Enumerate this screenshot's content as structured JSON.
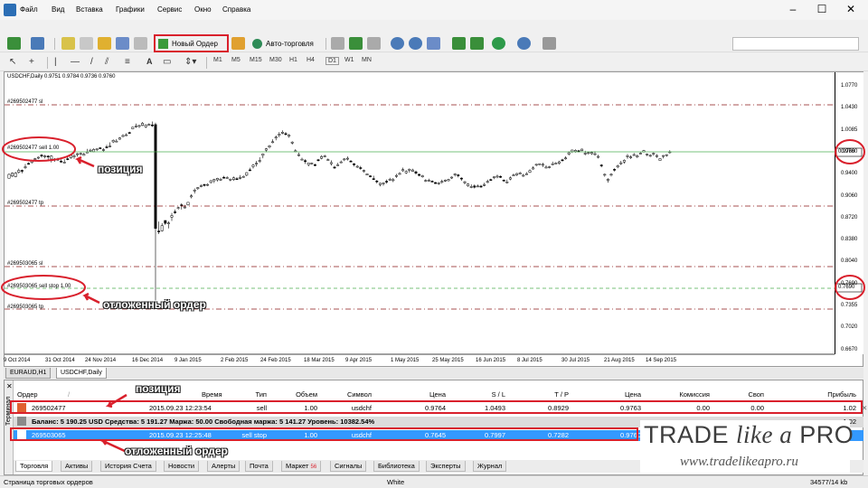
{
  "menu": [
    "Файл",
    "Вид",
    "Вставка",
    "Графики",
    "Сервис",
    "Окно",
    "Справка"
  ],
  "window_controls": {
    "minimize": "–",
    "maximize": "☐",
    "close": "✕"
  },
  "inner_controls": {
    "minimize": "_",
    "close": "✕"
  },
  "toolbar": {
    "new_order": "Новый Ордер",
    "auto_trading": "Авто-торговля"
  },
  "timeframes": [
    "M1",
    "M5",
    "M15",
    "M30",
    "H1",
    "H4",
    "D1",
    "W1",
    "MN"
  ],
  "chart": {
    "title": "USDCHF,Daily  0.9751 0.9784 0.9736 0.9760",
    "price_labels": [
      "1.0770",
      "1.0430",
      "1.0085",
      "0.9760",
      "0.9400",
      "0.9060",
      "0.8720",
      "0.8380",
      "0.8040",
      "0.7690",
      "0.7355",
      "0.7020",
      "0.6670"
    ],
    "date_labels": [
      "9 Oct 2014",
      "31 Oct 2014",
      "24 Nov 2014",
      "16 Dec 2014",
      "9 Jan 2015",
      "2 Feb 2015",
      "24 Feb 2015",
      "18 Mar 2015",
      "9 Apr 2015",
      "1 May 2015",
      "25 May 2015",
      "16 Jun 2015",
      "8 Jul 2015",
      "30 Jul 2015",
      "21 Aug 2015",
      "14 Sep 2015"
    ],
    "lines": {
      "l1": "#269502477 sl",
      "l2": "#269502477 sell 1.00",
      "l3": "#269502477 tp",
      "l4": "#269503065 sl",
      "l5": "#269503065 sell stop 1.00",
      "l6": "#269503065 tp"
    },
    "current_price": "0.9760",
    "pending_price": "0.7690"
  },
  "annotations": {
    "position": "позиция",
    "pending_order": "отложенный ордер"
  },
  "chart_tabs": [
    "EURAUD,H1",
    "USDCHF,Daily"
  ],
  "terminal": {
    "side_label": "Терминал",
    "headers": {
      "order": "Ордер",
      "time": "Время",
      "type": "Тип",
      "volume": "Объем",
      "symbol": "Символ",
      "price": "Цена",
      "sl": "S / L",
      "tp": "T / P",
      "price2": "Цена",
      "commission": "Комиссия",
      "swap": "Своп",
      "profit": "Прибыль"
    },
    "row1": {
      "order": "269502477",
      "time": "2015.09.23 12:23:54",
      "type": "sell",
      "volume": "1.00",
      "symbol": "usdchf",
      "price": "0.9764",
      "sl": "1.0493",
      "tp": "0.8929",
      "price2": "0.9763",
      "commission": "0.00",
      "swap": "0.00",
      "profit": "1.02"
    },
    "balance": "Баланс: 5 190.25 USD  Средства: 5 191.27  Маржа: 50.00  Свободная маржа: 5 141.27  Уровень: 10382.54%",
    "balance_profit": "1.02",
    "row2": {
      "order": "269503065",
      "time": "2015.09.23 12:25:48",
      "type": "sell stop",
      "volume": "1.00",
      "symbol": "usdchf",
      "price": "0.7645",
      "sl": "0.7997",
      "tp": "0.7282",
      "price2": "0.9760"
    },
    "tabs": [
      "Торговля",
      "Активы",
      "История Счета",
      "Новости",
      "Алерты",
      "Почта",
      "Маркет",
      "Сигналы",
      "Библиотека",
      "Эксперты",
      "Журнал"
    ],
    "market_badge": "56"
  },
  "status": {
    "left": "Страница торговых ордеров",
    "center": "White",
    "right": "34577/14 kb"
  },
  "logo": {
    "line1a": "TRADE",
    "line1b": "like a",
    "line1c": "PRO",
    "line2": "www.tradelikeapro.ru"
  },
  "colors": {
    "accent_red": "#d9202c",
    "selected_blue": "#3399ff",
    "sl_tp_line": "#8b1a1a",
    "entry_line": "#4caf50"
  },
  "candles": [
    [
      0.9351,
      0.9425,
      0.9357,
      0.9411
    ],
    [
      0.9384,
      0.9442,
      0.9371,
      0.9431
    ],
    [
      0.9375,
      0.9449,
      0.9366,
      0.9431
    ],
    [
      0.9442,
      0.9499,
      0.9422,
      0.9474
    ],
    [
      0.9473,
      0.9485,
      0.9427,
      0.9469
    ],
    [
      0.9525,
      0.9571,
      0.9492,
      0.9528
    ],
    [
      0.9581,
      0.9597,
      0.9562,
      0.9579
    ],
    [
      0.9595,
      0.9638,
      0.9578,
      0.9626
    ],
    [
      0.9643,
      0.9665,
      0.9627,
      0.9654
    ],
    [
      0.9675,
      0.9687,
      0.9647,
      0.9676
    ],
    [
      0.9709,
      0.9729,
      0.9669,
      0.9705
    ],
    [
      0.9694,
      0.9712,
      0.9658,
      0.9696
    ],
    [
      0.9694,
      0.9707,
      0.9638,
      0.9688
    ],
    [
      0.9648,
      0.9705,
      0.9595,
      0.9694
    ],
    [
      0.9648,
      0.9662,
      0.9606,
      0.9638
    ],
    [
      0.9639,
      0.9669,
      0.9618,
      0.9647
    ],
    [
      0.9616,
      0.9646,
      0.9589,
      0.9609
    ],
    [
      0.9599,
      0.9645,
      0.9583,
      0.9601
    ],
    [
      0.9653,
      0.9681,
      0.9631,
      0.9641
    ],
    [
      0.9667,
      0.9711,
      0.9652,
      0.9705
    ],
    [
      0.9682,
      0.9725,
      0.9651,
      0.9698
    ],
    [
      0.9718,
      0.9742,
      0.9685,
      0.9731
    ],
    [
      0.9721,
      0.9747,
      0.9706,
      0.9735
    ],
    [
      0.9705,
      0.9745,
      0.9702,
      0.9722
    ],
    [
      0.9752,
      0.9805,
      0.9746,
      0.9757
    ],
    [
      0.9785,
      0.9808,
      0.9783,
      0.9786
    ],
    [
      0.9761,
      0.9815,
      0.9753,
      0.9798
    ],
    [
      0.9795,
      0.981,
      0.9773,
      0.9805
    ],
    [
      0.9822,
      0.9834,
      0.9804,
      0.9812
    ],
    [
      0.9781,
      0.9817,
      0.9759,
      0.9795
    ],
    [
      0.9837,
      0.9869,
      0.9813,
      0.9829
    ],
    [
      0.9847,
      0.9907,
      0.9828,
      0.9852
    ],
    [
      0.9914,
      0.9953,
      0.9896,
      0.9938
    ],
    [
      0.9922,
      0.9958,
      0.9917,
      0.9926
    ],
    [
      0.9955,
      0.9987,
      0.9946,
      0.9976
    ],
    [
      0.9997,
      1.0032,
      0.9988,
      1.0012
    ],
    [
      1.0022,
      1.0047,
      1.0007,
      1.0024
    ],
    [
      1.0059,
      1.0071,
      1.0045,
      1.0053
    ],
    [
      1.0116,
      1.0147,
      1.0109,
      1.0141
    ],
    [
      1.0149,
      1.0197,
      1.0133,
      1.016
    ],
    [
      1.0164,
      1.0178,
      1.0129,
      1.0167
    ],
    [
      1.0169,
      1.0222,
      1.0158,
      1.0203
    ],
    [
      1.0146,
      1.0187,
      1.0127,
      1.0174
    ],
    [
      1.0183,
      1.02,
      1.0164,
      1.0187
    ],
    [
      1.0177,
      1.0228,
      1.0145,
      1.0164
    ],
    [
      1.0182,
      1.0212,
      0.746,
      0.8573
    ],
    [
      0.8534,
      0.8681,
      0.8486,
      0.8533
    ],
    [
      0.8537,
      0.8656,
      0.8526,
      0.8618
    ],
    [
      0.8697,
      0.8697,
      0.8629,
      0.8653
    ],
    [
      0.8657,
      0.8687,
      0.8575,
      0.8659
    ],
    [
      0.8749,
      0.8813,
      0.8689,
      0.8772
    ],
    [
      0.8831,
      0.8866,
      0.8799,
      0.883
    ],
    [
      0.8882,
      0.891,
      0.8867,
      0.8896
    ],
    [
      0.894,
      0.8964,
      0.8867,
      0.8928
    ],
    [
      0.8899,
      0.8938,
      0.8883,
      0.8905
    ],
    [
      0.8938,
      0.8979,
      0.8928,
      0.8978
    ],
    [
      0.9062,
      0.9105,
      0.9039,
      0.9078
    ],
    [
      0.9157,
      0.9193,
      0.9114,
      0.9168
    ],
    [
      0.9189,
      0.9215,
      0.9172,
      0.9207
    ],
    [
      0.9221,
      0.9255,
      0.9211,
      0.9236
    ],
    [
      0.9255,
      0.9264,
      0.9221,
      0.9239
    ],
    [
      0.9245,
      0.9271,
      0.9229,
      0.9255
    ],
    [
      0.9285,
      0.9322,
      0.9271,
      0.9313
    ],
    [
      0.9312,
      0.9342,
      0.9277,
      0.9332
    ],
    [
      0.9326,
      0.9358,
      0.93,
      0.935
    ],
    [
      0.9323,
      0.9358,
      0.9312,
      0.9336
    ],
    [
      0.9366,
      0.9388,
      0.9345,
      0.9357
    ],
    [
      0.9356,
      0.9381,
      0.9346,
      0.9362
    ],
    [
      0.9334,
      0.9348,
      0.9305,
      0.9337
    ],
    [
      0.933,
      0.9377,
      0.9311,
      0.9358
    ],
    [
      0.9344,
      0.9368,
      0.9328,
      0.9341
    ],
    [
      0.9349,
      0.94,
      0.9333,
      0.9365
    ],
    [
      0.9377,
      0.9395,
      0.9362,
      0.9378
    ],
    [
      0.9398,
      0.9443,
      0.9383,
      0.9438
    ],
    [
      0.9481,
      0.9514,
      0.9464,
      0.9478
    ],
    [
      0.9532,
      0.9572,
      0.9501,
      0.9553
    ],
    [
      0.9574,
      0.9618,
      0.9533,
      0.9584
    ],
    [
      0.9618,
      0.9676,
      0.9588,
      0.9626
    ],
    [
      0.9705,
      0.9736,
      0.9661,
      0.9728
    ],
    [
      0.9786,
      0.9819,
      0.9756,
      0.9807
    ],
    [
      0.9833,
      0.9866,
      0.9812,
      0.9853
    ],
    [
      0.9915,
      0.9954,
      0.9893,
      0.9916
    ],
    [
      0.9977,
      1.0013,
      0.9938,
      0.9987
    ],
    [
      1.0017,
      1.0066,
      0.9986,
      1.0034
    ],
    [
      1.0048,
      1.0092,
      1.0033,
      1.0064
    ],
    [
      1.0042,
      1.0068,
      1.0014,
      1.0036
    ],
    [
      1.0,
      1.0037,
      0.9979,
      1.0021
    ],
    [
      0.9896,
      0.9925,
      0.9873,
      0.9911
    ],
    [
      0.9766,
      0.98,
      0.9753,
      0.9776
    ],
    [
      0.9707,
      0.9747,
      0.9688,
      0.9716
    ],
    [
      0.9641,
      0.9669,
      0.9629,
      0.9646
    ],
    [
      0.9624,
      0.9646,
      0.9573,
      0.9609
    ],
    [
      0.9562,
      0.9591,
      0.9535,
      0.9587
    ],
    [
      0.9585,
      0.9596,
      0.9562,
      0.9586
    ],
    [
      0.9561,
      0.9576,
      0.9536,
      0.9554
    ],
    [
      0.9637,
      0.965,
      0.9611,
      0.9623
    ],
    [
      0.9659,
      0.9707,
      0.9644,
      0.9687
    ],
    [
      0.9683,
      0.9713,
      0.9675,
      0.9697
    ],
    [
      0.9632,
      0.9656,
      0.9621,
      0.964
    ],
    [
      0.9576,
      0.9628,
      0.9546,
      0.9593
    ],
    [
      0.9523,
      0.9544,
      0.9496,
      0.952
    ],
    [
      0.9557,
      0.9589,
      0.9542,
      0.956
    ],
    [
      0.9601,
      0.9625,
      0.9585,
      0.9604
    ],
    [
      0.9641,
      0.966,
      0.9617,
      0.965
    ],
    [
      0.9654,
      0.9688,
      0.9626,
      0.9661
    ],
    [
      0.9617,
      0.9634,
      0.9599,
      0.9608
    ],
    [
      0.9575,
      0.9585,
      0.9532,
      0.9559
    ],
    [
      0.9531,
      0.9554,
      0.951,
      0.9536
    ],
    [
      0.9515,
      0.9541,
      0.9482,
      0.9502
    ],
    [
      0.9457,
      0.9486,
      0.9439,
      0.9472
    ],
    [
      0.9401,
      0.9426,
      0.9395,
      0.9418
    ],
    [
      0.9388,
      0.9397,
      0.9364,
      0.9386
    ],
    [
      0.9345,
      0.9389,
      0.9325,
      0.9336
    ],
    [
      0.9309,
      0.9325,
      0.927,
      0.9298
    ],
    [
      0.9252,
      0.9283,
      0.9225,
      0.9272
    ],
    [
      0.9274,
      0.929,
      0.9236,
      0.9278
    ],
    [
      0.9305,
      0.9331,
      0.9266,
      0.9291
    ],
    [
      0.9326,
      0.9357,
      0.931,
      0.9337
    ],
    [
      0.9318,
      0.9354,
      0.9292,
      0.9328
    ],
    [
      0.9388,
      0.9419,
      0.9356,
      0.9394
    ],
    [
      0.9416,
      0.9447,
      0.9405,
      0.9425
    ],
    [
      0.9467,
      0.9516,
      0.9452,
      0.9484
    ],
    [
      0.9435,
      0.9473,
      0.9418,
      0.9456
    ],
    [
      0.9473,
      0.9503,
      0.9438,
      0.9491
    ],
    [
      0.9457,
      0.9497,
      0.945,
      0.9479
    ],
    [
      0.9451,
      0.9469,
      0.9406,
      0.943
    ],
    [
      0.9412,
      0.9421,
      0.9379,
      0.9395
    ],
    [
      0.9372,
      0.9401,
      0.9359,
      0.9391
    ],
    [
      0.9311,
      0.9335,
      0.9293,
      0.9318
    ],
    [
      0.9311,
      0.9344,
      0.9302,
      0.9322
    ],
    [
      0.9306,
      0.9317,
      0.9289,
      0.9304
    ],
    [
      0.9285,
      0.9293,
      0.9265,
      0.9268
    ],
    [
      0.9267,
      0.9293,
      0.9248,
      0.9279
    ],
    [
      0.9295,
      0.933,
      0.9267,
      0.9302
    ],
    [
      0.9312,
      0.9333,
      0.9294,
      0.9322
    ],
    [
      0.9313,
      0.9342,
      0.9302,
      0.9331
    ],
    [
      0.9354,
      0.9379,
      0.9339,
      0.9368
    ],
    [
      0.9402,
      0.943,
      0.9378,
      0.9418
    ],
    [
      0.9403,
      0.9418,
      0.9363,
      0.9392
    ],
    [
      0.9353,
      0.9365,
      0.9312,
      0.934
    ],
    [
      0.9282,
      0.9311,
      0.9257,
      0.9296
    ],
    [
      0.9233,
      0.9274,
      0.9217,
      0.9263
    ],
    [
      0.9213,
      0.9256,
      0.9196,
      0.9222
    ],
    [
      0.9232,
      0.9254,
      0.9193,
      0.9212
    ],
    [
      0.9228,
      0.9253,
      0.9215,
      0.923
    ],
    [
      0.9229,
      0.9248,
      0.9202,
      0.9225
    ],
    [
      0.9248,
      0.928,
      0.9227,
      0.9253
    ],
    [
      0.9291,
      0.9329,
      0.9274,
      0.9301
    ],
    [
      0.9331,
      0.9343,
      0.9319,
      0.9329
    ],
    [
      0.9361,
      0.9378,
      0.9337,
      0.9372
    ],
    [
      0.9374,
      0.9407,
      0.9351,
      0.9383
    ],
    [
      0.9379,
      0.9394,
      0.9355,
      0.9372
    ],
    [
      0.9323,
      0.9331,
      0.9296,
      0.9317
    ],
    [
      0.9287,
      0.933,
      0.9272,
      0.9295
    ],
    [
      0.9338,
      0.9379,
      0.9319,
      0.9357
    ],
    [
      0.9395,
      0.9422,
      0.9383,
      0.9402
    ],
    [
      0.9402,
      0.9433,
      0.9385,
      0.9424
    ],
    [
      0.9416,
      0.9451,
      0.9411,
      0.9434
    ],
    [
      0.9385,
      0.9419,
      0.9371,
      0.9397
    ],
    [
      0.9415,
      0.9445,
      0.9409,
      0.9421
    ],
    [
      0.9443,
      0.9488,
      0.9431,
      0.9469
    ],
    [
      0.9494,
      0.9537,
      0.9484,
      0.9511
    ],
    [
      0.9553,
      0.9573,
      0.9536,
      0.9567
    ],
    [
      0.9567,
      0.9581,
      0.9555,
      0.9575
    ],
    [
      0.9553,
      0.959,
      0.9524,
      0.9566
    ],
    [
      0.9518,
      0.9552,
      0.9503,
      0.9523
    ],
    [
      0.9517,
      0.9542,
      0.9503,
      0.9529
    ],
    [
      0.9569,
      0.9607,
      0.9553,
      0.9575
    ],
    [
      0.9584,
      0.96,
      0.9567,
      0.9587
    ],
    [
      0.9582,
      0.9622,
      0.9562,
      0.9606
    ],
    [
      0.9636,
      0.9651,
      0.9611,
      0.9629
    ],
    [
      0.9659,
      0.969,
      0.9638,
      0.9665
    ],
    [
      0.9724,
      0.9766,
      0.9704,
      0.9746
    ],
    [
      0.9763,
      0.9795,
      0.9743,
      0.9788
    ],
    [
      0.9763,
      0.9798,
      0.9748,
      0.9783
    ],
    [
      0.9777,
      0.9789,
      0.9752,
      0.9761
    ],
    [
      0.9777,
      0.9809,
      0.9771,
      0.9802
    ],
    [
      0.973,
      0.9776,
      0.9705,
      0.9739
    ],
    [
      0.9734,
      0.9762,
      0.972,
      0.9748
    ],
    [
      0.9732,
      0.9767,
      0.9712,
      0.9749
    ],
    [
      0.9724,
      0.9768,
      0.9704,
      0.9731
    ],
    [
      0.9685,
      0.9714,
      0.9656,
      0.9689
    ],
    [
      0.9556,
      0.9569,
      0.9521,
      0.9548
    ],
    [
      0.9398,
      0.9423,
      0.9375,
      0.9412
    ],
    [
      0.9317,
      0.9353,
      0.9282,
      0.9336
    ],
    [
      0.94,
      0.9426,
      0.9379,
      0.9413
    ],
    [
      0.9489,
      0.9504,
      0.9455,
      0.9478
    ],
    [
      0.9524,
      0.9561,
      0.9507,
      0.9544
    ],
    [
      0.9584,
      0.962,
      0.9555,
      0.959
    ],
    [
      0.9603,
      0.9643,
      0.9576,
      0.9629
    ],
    [
      0.9685,
      0.9727,
      0.9651,
      0.9699
    ],
    [
      0.9667,
      0.9706,
      0.9648,
      0.9681
    ],
    [
      0.9705,
      0.974,
      0.9698,
      0.9717
    ],
    [
      0.9679,
      0.9718,
      0.9664,
      0.9698
    ],
    [
      0.9732,
      0.9753,
      0.9723,
      0.974
    ],
    [
      0.9758,
      0.979,
      0.9751,
      0.9779
    ],
    [
      0.9719,
      0.9735,
      0.9694,
      0.9725
    ],
    [
      0.9699,
      0.972,
      0.968,
      0.9706
    ],
    [
      0.9724,
      0.975,
      0.97,
      0.9738
    ],
    [
      0.969,
      0.9725,
      0.9666,
      0.9702
    ],
    [
      0.9627,
      0.9659,
      0.9624,
      0.9654
    ],
    [
      0.9693,
      0.971,
      0.9659,
      0.9703
    ],
    [
      0.9705,
      0.9723,
      0.9684,
      0.9716
    ],
    [
      0.9751,
      0.9784,
      0.9736,
      0.976
    ]
  ]
}
